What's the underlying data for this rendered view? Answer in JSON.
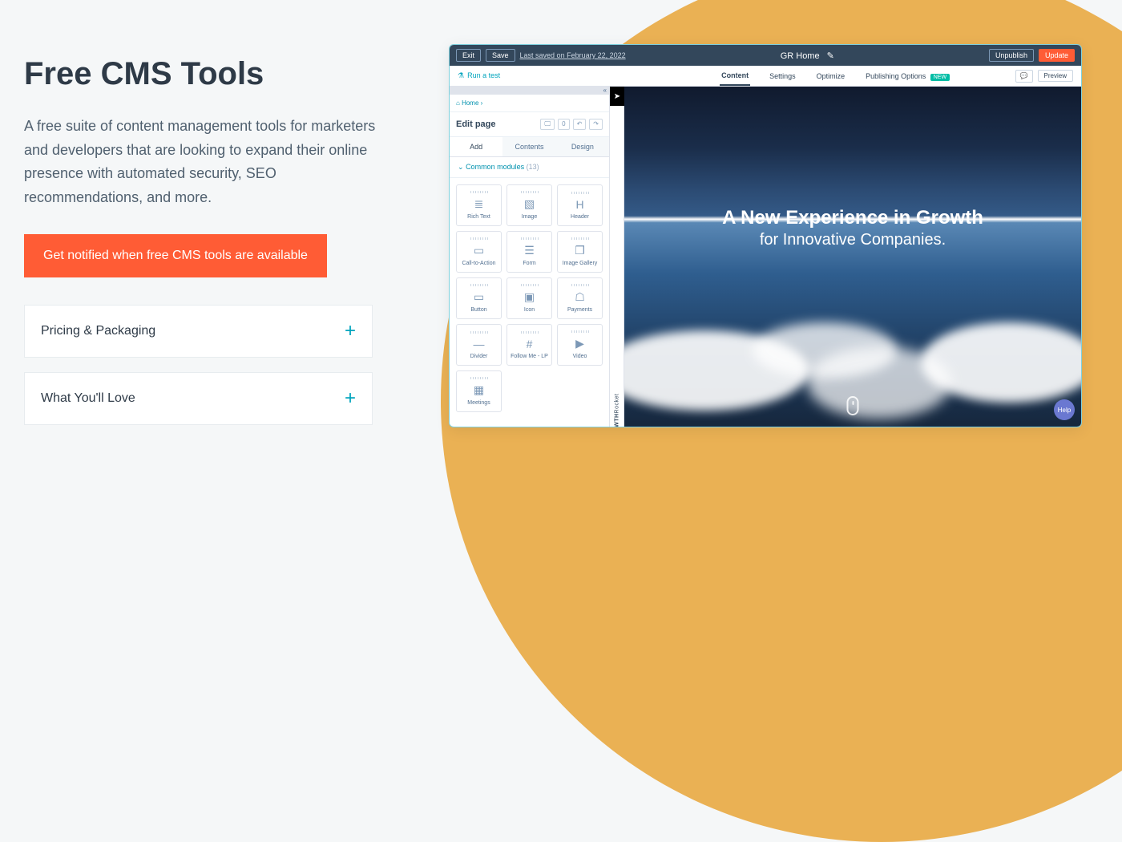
{
  "left": {
    "heading": "Free CMS Tools",
    "sub": "A free suite of content management tools for marketers and developers that are looking to expand their online presence with automated security, SEO recommendations, and more.",
    "cta": "Get notified when free CMS tools are available",
    "accordions": [
      "Pricing & Packaging",
      "What You'll Love"
    ]
  },
  "shot": {
    "topbar": {
      "exit": "Exit",
      "save": "Save",
      "last_saved": "Last saved on February 22, 2022",
      "title": "GR Home",
      "unpublish": "Unpublish",
      "update": "Update"
    },
    "tabs": {
      "run": "Run a test",
      "items": [
        "Content",
        "Settings",
        "Optimize",
        "Publishing Options"
      ],
      "new": "NEW",
      "preview": "Preview"
    },
    "sidebar": {
      "collapse": "«",
      "crumb_icon": "⌂",
      "crumb": "Home",
      "crumb_sep": "›",
      "edit_page": "Edit page",
      "count": "0",
      "subtabs": [
        "Add",
        "Contents",
        "Design"
      ],
      "section_chev": "⌄",
      "section": "Common modules",
      "section_count": "(13)",
      "modules": [
        {
          "label": "Rich Text",
          "icon": "≣"
        },
        {
          "label": "Image",
          "icon": "▧"
        },
        {
          "label": "Header",
          "icon": "H"
        },
        {
          "label": "Call-to-Action",
          "icon": "▭"
        },
        {
          "label": "Form",
          "icon": "☰"
        },
        {
          "label": "Image Gallery",
          "icon": "❐"
        },
        {
          "label": "Button",
          "icon": "▭"
        },
        {
          "label": "Icon",
          "icon": "▣"
        },
        {
          "label": "Payments",
          "icon": "☖"
        },
        {
          "label": "Divider",
          "icon": "—"
        },
        {
          "label": "Follow Me - LP",
          "icon": "#"
        },
        {
          "label": "Video",
          "icon": "▶"
        },
        {
          "label": "Meetings",
          "icon": "▦"
        }
      ]
    },
    "rail": {
      "rocket": "➤",
      "brand_bold": "GROWTH",
      "brand_rest": "Rocket"
    },
    "hero": {
      "line1": "A New Experience in Growth",
      "line2": "for Innovative Companies."
    },
    "help": "Help"
  }
}
